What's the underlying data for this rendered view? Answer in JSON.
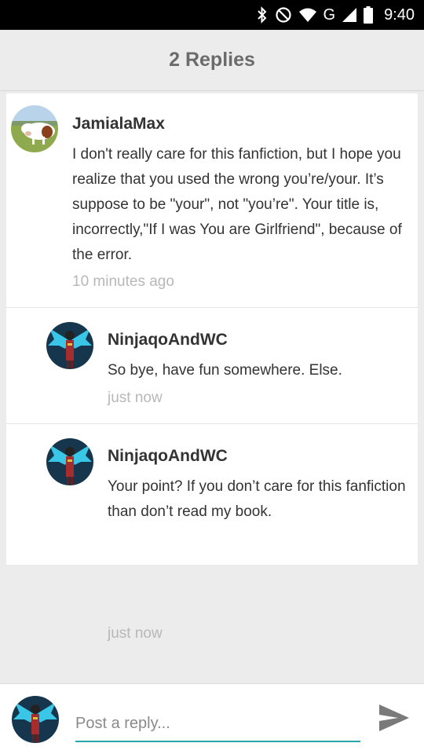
{
  "status_bar": {
    "network": "G",
    "time": "9:40"
  },
  "header": {
    "title": "2 Replies"
  },
  "comments": [
    {
      "author": "JamialaMax",
      "body": "I don't really care for this fanfiction, but I hope you realize that you used the wrong you’re/your. It’s suppose to be \"your\", not \"you’re\". Your title is, incorrectly,\"If I was You are Girlfriend\", because of the error.",
      "time": "10 minutes ago",
      "avatar": "cow-avatar"
    },
    {
      "author": "NinjaqoAndWC",
      "body": "So bye, have fun somewhere. Else.",
      "time": "just now",
      "avatar": "ninja-avatar"
    },
    {
      "author": "NinjaqoAndWC",
      "body": "Your point? If you don’t care for this fanfiction than don’t read my book.",
      "time": "just now",
      "avatar": "ninja-avatar"
    }
  ],
  "reply_bar": {
    "placeholder": "Post a reply...",
    "value": "",
    "accent_color": "#2aa5a8"
  },
  "icons": {
    "bluetooth": "bluetooth-icon",
    "do_not_disturb": "do-not-disturb-icon",
    "wifi": "wifi-icon",
    "signal": "signal-icon",
    "battery": "battery-icon",
    "send": "send-icon"
  }
}
